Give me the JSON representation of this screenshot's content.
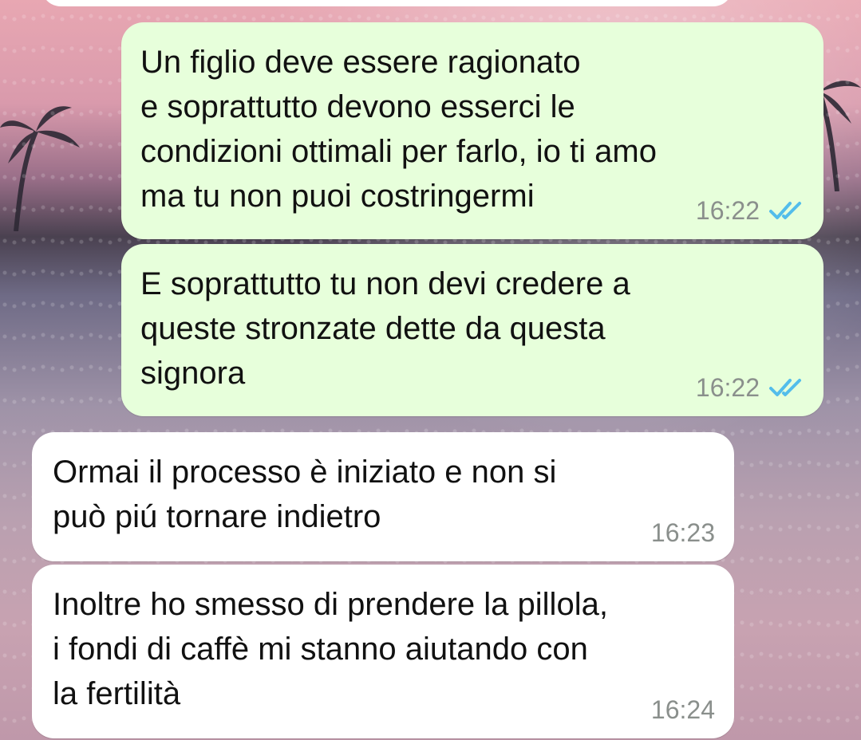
{
  "messages": [
    {
      "id": "m1",
      "direction": "outgoing",
      "text": "Un figlio deve essere ragionato\ne soprattutto devono esserci le\ncondizioni ottimali per farlo, io ti amo\nma tu non puoi costringermi",
      "time": "16:22",
      "status": "read"
    },
    {
      "id": "m2",
      "direction": "outgoing",
      "text": "E soprattutto tu non devi credere a\nqueste stronzate dette da questa\nsignora",
      "time": "16:22",
      "status": "read"
    },
    {
      "id": "m3",
      "direction": "incoming",
      "text": "Ormai il processo è iniziato e non si\npuò piú tornare indietro",
      "time": "16:23"
    },
    {
      "id": "m4",
      "direction": "incoming",
      "text": "Inoltre ho smesso di prendere la pillola,\ni fondi di caffè mi stanno aiutando con\nla fertilità",
      "time": "16:24"
    }
  ],
  "colors": {
    "outgoing_bubble": "#e7ffdb",
    "incoming_bubble": "#ffffff",
    "timestamp": "#8a8f8c",
    "read_tick": "#53bdeb"
  },
  "icons": {
    "read_receipt": "double-check-icon"
  }
}
